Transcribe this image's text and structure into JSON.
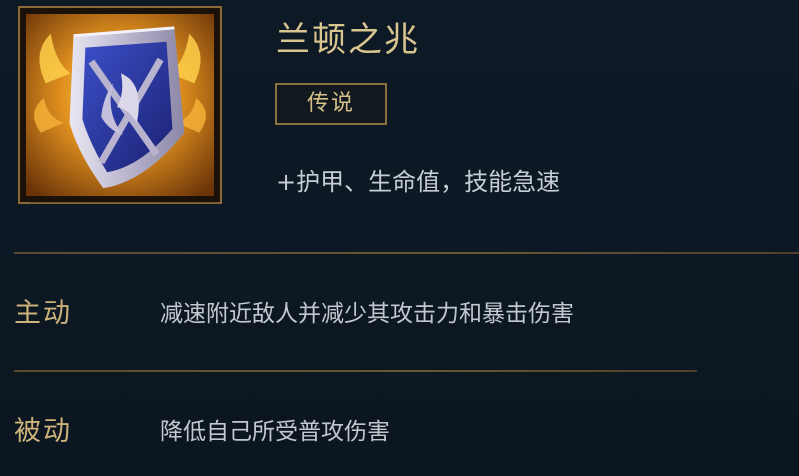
{
  "item": {
    "name": "兰顿之兆",
    "rarity": "传说",
    "stats": "+护甲、生命值，技能急速",
    "icon": "shield-icon"
  },
  "abilities": [
    {
      "label": "主动",
      "description": "减速附近敌人并减少其攻击力和暴击伤害"
    },
    {
      "label": "被动",
      "description": "降低自己所受普攻伤害"
    }
  ],
  "colors": {
    "background": "#0c1823",
    "accent_gold": "#d9c58f",
    "label_gold": "#cdb27a",
    "body_text": "#c3c8ce",
    "divider": "#6b5634"
  }
}
